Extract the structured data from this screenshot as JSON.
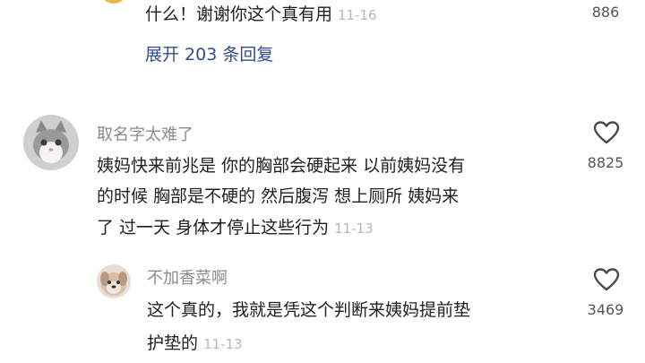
{
  "comments": [
    {
      "text": "什么！谢谢你这个真有用",
      "time": "11-16",
      "likes": "886",
      "expand_label": "展开 203 条回复"
    },
    {
      "username": "取名字太难了",
      "lines": [
        "姨妈快来前兆是 你的胸部会硬起来 以前姨妈没有",
        "的时候 胸部是不硬的 然后腹泻 想上厕所 姨妈来",
        "了 过一天 身体才停止这些行为"
      ],
      "time": "11-13",
      "likes": "8825"
    },
    {
      "username": "不加香菜啊",
      "lines": [
        "这个真的，我就是凭这个判断来姨妈提前垫",
        "护垫的"
      ],
      "time": "11-13",
      "likes": "3469"
    }
  ],
  "icons": {
    "like": "heart-outline-icon",
    "avatar_cat": "cat-avatar-icon",
    "avatar_dog": "dog-avatar-icon"
  }
}
